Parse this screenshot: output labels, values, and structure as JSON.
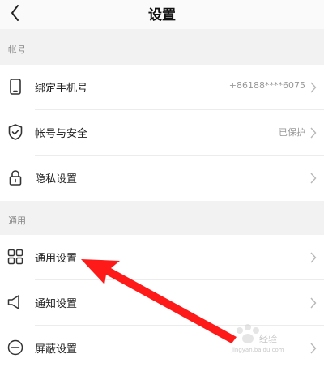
{
  "header": {
    "title": "设置",
    "back_icon": "back-chevron-icon"
  },
  "sections": [
    {
      "title": "帐号",
      "items": [
        {
          "label": "绑定手机号",
          "value": "+86188****6075",
          "icon": "phone-icon"
        },
        {
          "label": "帐号与安全",
          "value": "已保护",
          "icon": "shield-icon"
        },
        {
          "label": "隐私设置",
          "value": "",
          "icon": "lock-icon"
        }
      ]
    },
    {
      "title": "通用",
      "items": [
        {
          "label": "通用设置",
          "value": "",
          "icon": "grid-icon"
        },
        {
          "label": "通知设置",
          "value": "",
          "icon": "speaker-icon"
        },
        {
          "label": "屏蔽设置",
          "value": "",
          "icon": "block-icon"
        }
      ]
    }
  ],
  "annotation": {
    "arrow_color": "#ff1a1a",
    "points_to": "通用设置"
  },
  "watermark": {
    "text": "经验",
    "url": "jingyan.baidu.com"
  },
  "colors": {
    "background": "#f2f2f2",
    "row_background": "#ffffff",
    "secondary_text": "#999999"
  }
}
